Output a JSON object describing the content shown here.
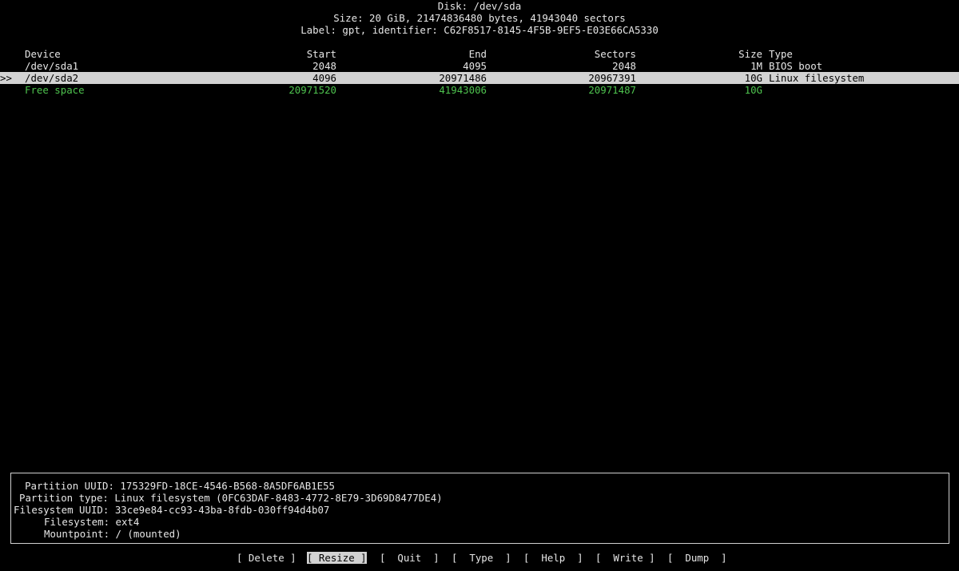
{
  "header": {
    "disk": "Disk: /dev/sda",
    "size": "Size: 20 GiB, 21474836480 bytes, 41943040 sectors",
    "label": "Label: gpt, identifier: C62F8517-8145-4F5B-9EF5-E03E66CA5330"
  },
  "table": {
    "columns": {
      "device": "Device",
      "start": "Start",
      "end": "End",
      "sectors": "Sectors",
      "size": "Size",
      "type": "Type"
    },
    "rows": [
      {
        "marker": "",
        "device": "/dev/sda1",
        "start": "2048",
        "end": "4095",
        "sectors": "2048",
        "size": "1M",
        "type": "BIOS boot"
      },
      {
        "marker": ">>",
        "device": "/dev/sda2",
        "start": "4096",
        "end": "20971486",
        "sectors": "20967391",
        "size": "10G",
        "type": "Linux filesystem"
      },
      {
        "marker": "",
        "device": "Free space",
        "start": "20971520",
        "end": "41943006",
        "sectors": "20971487",
        "size": "10G",
        "type": ""
      }
    ]
  },
  "details": {
    "partition_uuid": "Partition UUID: 175329FD-18CE-4546-B568-8A5DF6AB1E55",
    "partition_type": "Partition type: Linux filesystem (0FC63DAF-8483-4772-8E79-3D69D8477DE4)",
    "filesystem_uuid": "Filesystem UUID: 33ce9e84-cc93-43ba-8fdb-030ff94d4b07",
    "filesystem": "Filesystem: ext4",
    "mountpoint": "Mountpoint: / (mounted)"
  },
  "menu": {
    "delete": "[ Delete ]",
    "resize": "[ Resize ]",
    "quit": "[  Quit  ]",
    "type": "[  Type  ]",
    "help": "[  Help  ]",
    "write": "[  Write ]",
    "dump": "[  Dump  ]",
    "selected": "resize"
  },
  "colors": {
    "background": "#000000",
    "text": "#e6e6e6",
    "free_space": "#4ec24e",
    "selection": "#d2d2d2"
  }
}
